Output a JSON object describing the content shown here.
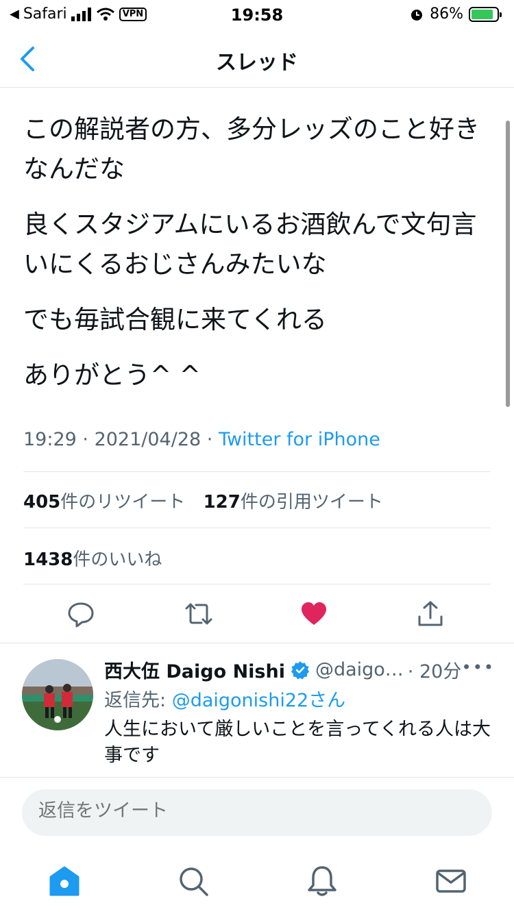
{
  "status_bar": {
    "carrier": "Safari",
    "vpn": "VPN",
    "time": "19:58",
    "battery": "86%",
    "battery_level": 0.86
  },
  "header": {
    "title": "スレッド"
  },
  "tweet": {
    "paragraphs": [
      "この解説者の方、多分レッズのこと好きなんだな",
      "良くスタジアムにいるお酒飲んで文句言いにくるおじさんみたいな",
      "でも毎試合観に来てくれる",
      "ありがとう^ ^"
    ],
    "time": "19:29",
    "date": "2021/04/28",
    "separator": " · ",
    "source": "Twitter for iPhone",
    "stats": {
      "retweets_count": "405",
      "retweets_label": "件のリツイート",
      "quotes_count": "127",
      "quotes_label": "件の引用ツイート",
      "likes_count": "1438",
      "likes_label": "件のいいね"
    },
    "liked": true
  },
  "reply": {
    "name": "西大伍 Daigo Nishi",
    "handle": "@daigo…",
    "time": "· 20分",
    "reply_to_label": "返信先: ",
    "reply_to_handle": "@daigonishi22さん",
    "text": "人生において厳しいことを言ってくれる人は大事です"
  },
  "compose": {
    "placeholder": "返信をツイート"
  },
  "colors": {
    "accent": "#1d9bf0",
    "like": "#f91880",
    "muted": "#536471"
  },
  "tabs": [
    "home-icon",
    "search-icon",
    "notifications-icon",
    "messages-icon"
  ]
}
